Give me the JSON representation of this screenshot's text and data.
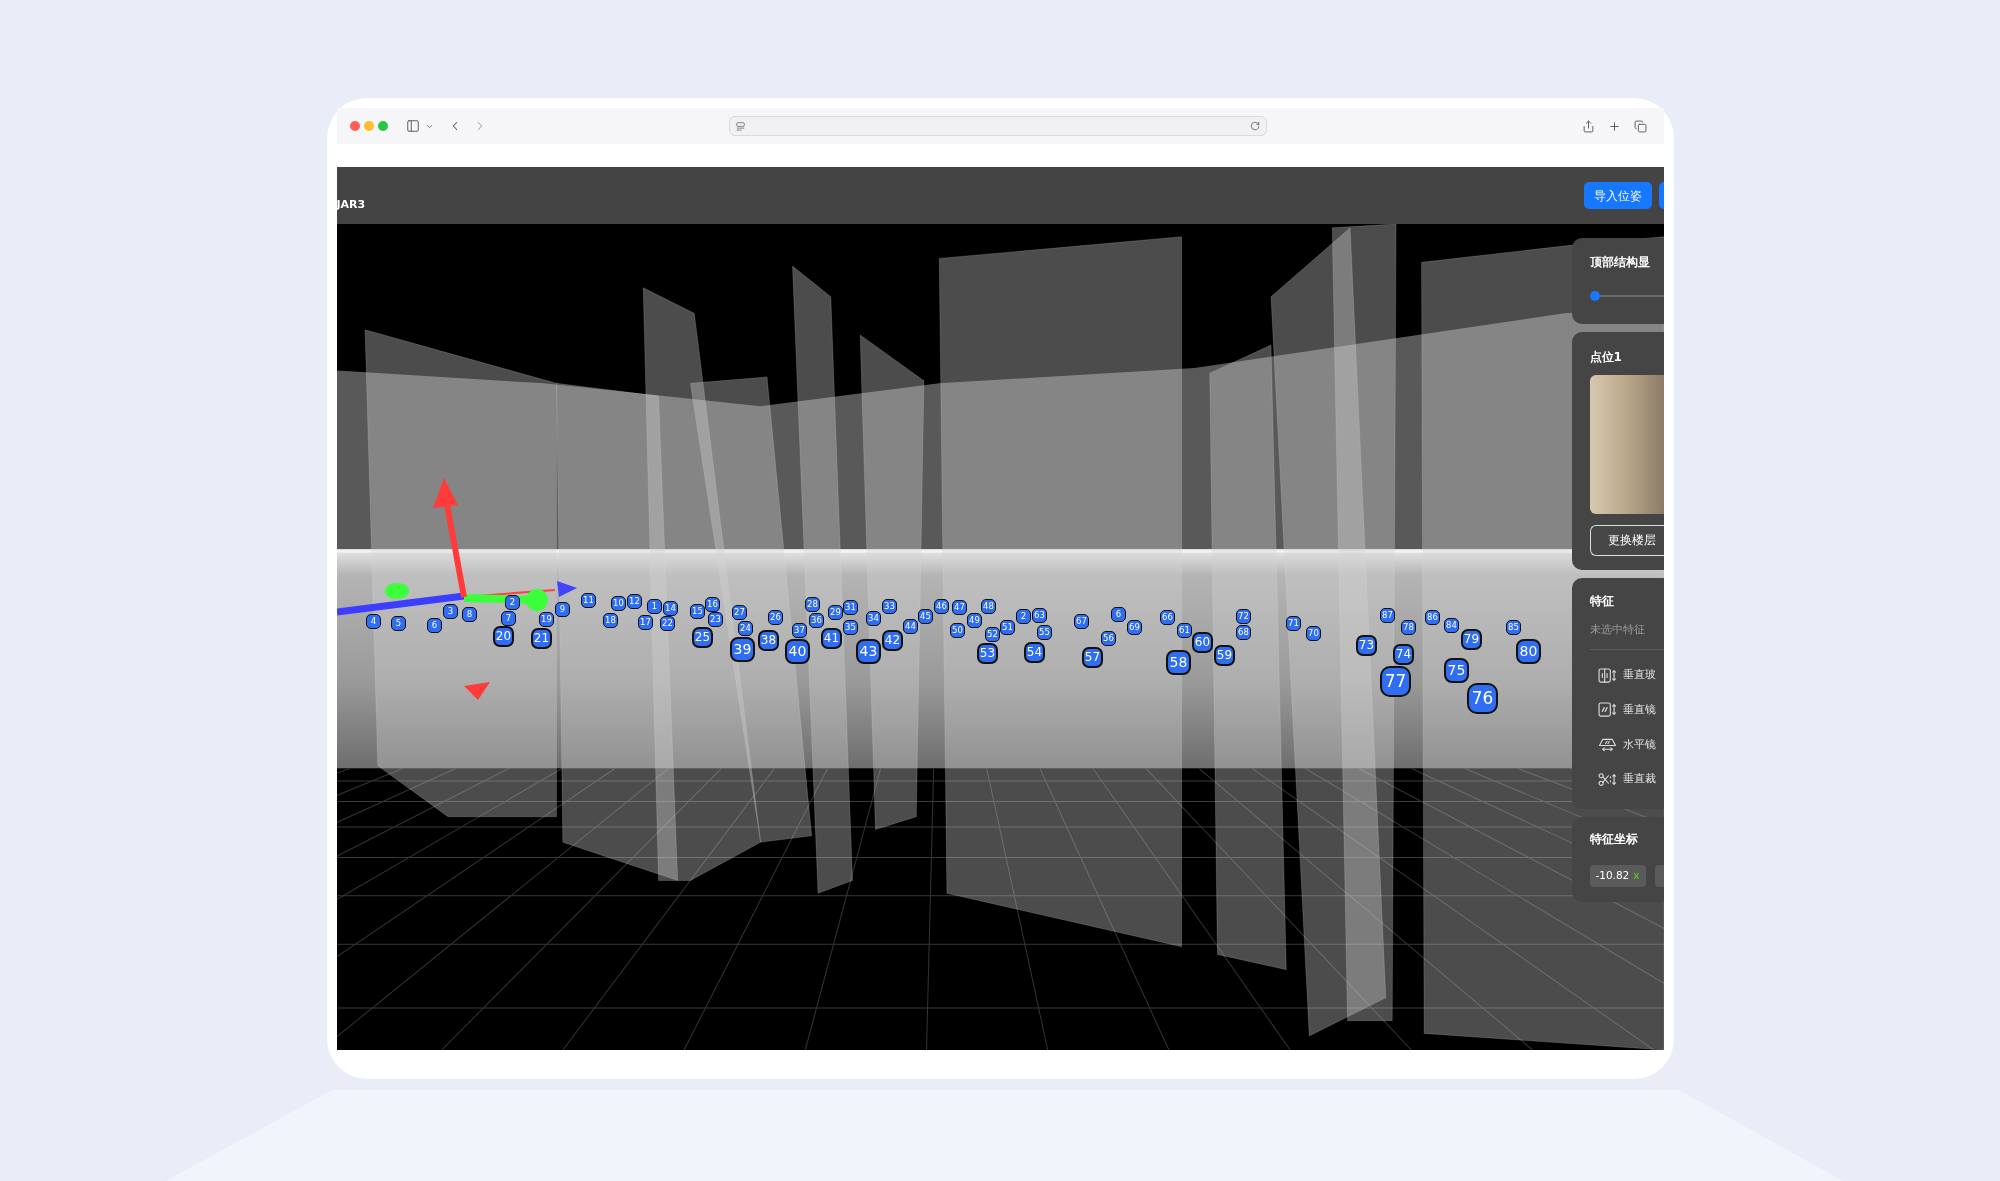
{
  "header": {
    "title": "JAR3",
    "buttons": [
      "导入位姿"
    ]
  },
  "viewport": {
    "markers": [
      "4",
      "5",
      "6",
      "3",
      "8",
      "2",
      "7",
      "20",
      "9",
      "19",
      "21",
      "11",
      "10",
      "12",
      "18",
      "1",
      "14",
      "17",
      "22",
      "15",
      "16",
      "23",
      "25",
      "27",
      "24",
      "26",
      "39",
      "38",
      "28",
      "36",
      "37",
      "29",
      "31",
      "35",
      "41",
      "40",
      "34",
      "33",
      "43",
      "42",
      "44",
      "45",
      "46",
      "47",
      "48",
      "49",
      "50",
      "51",
      "52",
      "53",
      "2",
      "63",
      "55",
      "54",
      "67",
      "6",
      "69",
      "56",
      "57",
      "66",
      "61",
      "60",
      "58",
      "59",
      "72",
      "68",
      "71",
      "70",
      "73",
      "87",
      "78",
      "74",
      "77",
      "86",
      "84",
      "79",
      "75",
      "76",
      "85",
      "80"
    ]
  },
  "panel": {
    "top_structure": {
      "title": "顶部结构显",
      "level": 0
    },
    "point": {
      "title": "点位1",
      "button": "更换楼层"
    },
    "features": {
      "title": "特征",
      "hint": "未选中特征",
      "items": [
        {
          "kind": "vertical_glass",
          "label": "垂直玻"
        },
        {
          "kind": "vertical_mirror",
          "label": "垂直镜"
        },
        {
          "kind": "horizontal_mirror",
          "label": "水平镜"
        },
        {
          "kind": "vertical_cut",
          "label": "垂直裁"
        }
      ]
    },
    "coordinates": {
      "title": "特征坐标",
      "fields": [
        {
          "value": "-10.82",
          "axis": "x"
        }
      ]
    }
  }
}
